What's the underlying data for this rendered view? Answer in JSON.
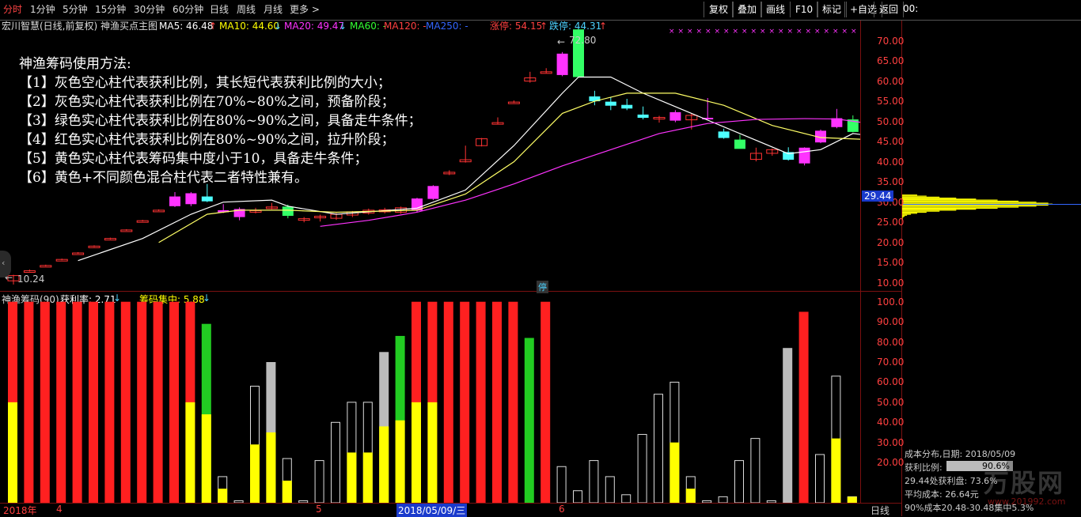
{
  "toolbar": {
    "periods": [
      {
        "label": "分时",
        "active": true
      },
      {
        "label": "1分钟",
        "active": false
      },
      {
        "label": "5分钟",
        "active": false
      },
      {
        "label": "15分钟",
        "active": false
      },
      {
        "label": "30分钟",
        "active": false
      },
      {
        "label": "60分钟",
        "active": false
      },
      {
        "label": "日线",
        "active": false
      },
      {
        "label": "周线",
        "active": false
      },
      {
        "label": "月线",
        "active": false
      },
      {
        "label": "更多 >",
        "active": false
      }
    ],
    "right_buttons": [
      "复权",
      "叠加",
      "画线",
      "F10",
      "标记",
      "+自选",
      "返回"
    ],
    "clock": "00:"
  },
  "info_line": {
    "title": "宏川智慧(日线,前复权) 神渔买点主图",
    "ma5": "MA5: 46.48",
    "ma5_arrow": "↑",
    "ma10": "MA10: 44.60",
    "ma10_arrow": "↓",
    "ma20": "MA20: 49.47",
    "ma20_arrow": "↓",
    "ma60": "MA60: -",
    "ma120": "MA120: -",
    "ma250": "MA250: -",
    "limit_up": "涨停: 54.15",
    "limit_up_arrow": "↑",
    "limit_down": "跌停: 44.31",
    "limit_down_arrow": "↑"
  },
  "instructions": [
    "神渔筹码使用方法:",
    "【1】灰色空心柱代表获利比例，其长短代表获利比例的大小；",
    "【2】灰色实心柱代表获利比例在70%~80%之间，预备阶段；",
    "【3】绿色实心柱代表获利比例在80%~90%之间，具备走牛条件；",
    "【4】红色实心柱代表获利比例在80%~90%之间，拉升阶段；",
    "【5】黄色实心柱代表筹码集中度小于10，具备走牛条件；",
    "【6】黄色+不同颜色混合柱代表二者特性兼有。"
  ],
  "main_axis": {
    "ticks": [
      "70.00",
      "65.00",
      "60.00",
      "55.00",
      "50.00",
      "45.00",
      "40.00",
      "35.00",
      "30.00",
      "25.00",
      "20.00",
      "15.00",
      "10.00"
    ],
    "current_price": "29.44",
    "high_label": "72.80",
    "low_label": "10.24",
    "stop_marker": "停"
  },
  "indicator": {
    "name": "神渔筹码(90)",
    "profit_rate": "获利率: 2.71",
    "profit_arrow": "↓",
    "concentration": "筹码集中: 5.88",
    "conc_arrow": "↓",
    "ticks": [
      "100.0",
      "90.00",
      "80.00",
      "70.00",
      "60.00",
      "50.00",
      "40.00",
      "30.00",
      "20.00"
    ]
  },
  "bottom_axis": {
    "labels": [
      "2018年",
      "4",
      "5",
      "2018/05/09/三",
      "6"
    ],
    "period_label": "日线"
  },
  "cost_distribution": {
    "title": "成本分布,日期: 2018/05/09",
    "profit_ratio_label": "获利比例:",
    "profit_ratio_value": "90.6%",
    "price_profit": "29.44处获利盘: 73.6%",
    "avg_cost": "平均成本: 26.64元",
    "range90": "90%成本20.48-30.48集中5.3%"
  },
  "watermark": "万股网",
  "watermark_url": "www.201992.com",
  "chart_data": {
    "type": "candlestick+bar",
    "main_ylim": [
      8,
      75
    ],
    "candles": [
      {
        "o": 10.5,
        "h": 12.0,
        "l": 9.6,
        "c": 11.8
      },
      {
        "o": 13.0,
        "h": 13.3,
        "l": 12.8,
        "c": 13.0
      },
      {
        "o": 14.3,
        "h": 14.5,
        "l": 14.1,
        "c": 14.3
      },
      {
        "o": 15.8,
        "h": 16.0,
        "l": 15.6,
        "c": 15.8
      },
      {
        "o": 17.4,
        "h": 17.6,
        "l": 17.2,
        "c": 17.4
      },
      {
        "o": 19.1,
        "h": 19.3,
        "l": 18.9,
        "c": 19.1
      },
      {
        "o": 21.0,
        "h": 21.2,
        "l": 20.8,
        "c": 21.0
      },
      {
        "o": 23.1,
        "h": 23.3,
        "l": 22.9,
        "c": 23.1
      },
      {
        "o": 25.4,
        "h": 25.6,
        "l": 25.2,
        "c": 25.4
      },
      {
        "o": 28.0,
        "h": 28.2,
        "l": 27.8,
        "c": 28.0
      },
      {
        "o": 29.0,
        "h": 32.5,
        "l": 28.8,
        "c": 31.4
      },
      {
        "o": 29.5,
        "h": 32.5,
        "l": 29.0,
        "c": 32.2
      },
      {
        "o": 31.4,
        "h": 34.5,
        "l": 30.0,
        "c": 30.2
      },
      {
        "o": 28.0,
        "h": 29.5,
        "l": 27.3,
        "c": 27.5
      },
      {
        "o": 26.3,
        "h": 28.7,
        "l": 25.5,
        "c": 28.3
      },
      {
        "o": 27.8,
        "h": 28.6,
        "l": 27.2,
        "c": 27.9
      },
      {
        "o": 28.6,
        "h": 29.8,
        "l": 28.2,
        "c": 28.8
      },
      {
        "o": 28.9,
        "h": 29.4,
        "l": 26.0,
        "c": 26.6
      },
      {
        "o": 25.6,
        "h": 26.3,
        "l": 25.0,
        "c": 25.9
      },
      {
        "o": 26.3,
        "h": 26.9,
        "l": 25.2,
        "c": 26.5
      },
      {
        "o": 26.0,
        "h": 27.3,
        "l": 25.6,
        "c": 27.0
      },
      {
        "o": 26.8,
        "h": 27.8,
        "l": 26.3,
        "c": 27.6
      },
      {
        "o": 27.3,
        "h": 28.4,
        "l": 26.9,
        "c": 28.0
      },
      {
        "o": 27.6,
        "h": 28.6,
        "l": 27.2,
        "c": 28.1
      },
      {
        "o": 27.5,
        "h": 28.9,
        "l": 27.1,
        "c": 28.6
      },
      {
        "o": 27.9,
        "h": 31.1,
        "l": 27.5,
        "c": 30.9
      },
      {
        "o": 30.8,
        "h": 34.2,
        "l": 30.5,
        "c": 34.0
      },
      {
        "o": 37.4,
        "h": 37.9,
        "l": 36.7,
        "c": 37.4
      },
      {
        "o": 40.0,
        "h": 44.0,
        "l": 39.8,
        "c": 40.5
      },
      {
        "o": 44.0,
        "h": 45.9,
        "l": 43.8,
        "c": 45.7
      },
      {
        "o": 49.7,
        "h": 51.0,
        "l": 49.3,
        "c": 49.7
      },
      {
        "o": 54.8,
        "h": 55.2,
        "l": 54.6,
        "c": 54.8
      },
      {
        "o": 60.0,
        "h": 62.3,
        "l": 59.6,
        "c": 60.8
      },
      {
        "o": 62.3,
        "h": 63.2,
        "l": 62.0,
        "c": 62.3
      },
      {
        "o": 61.5,
        "h": 67.2,
        "l": 61.2,
        "c": 66.8
      },
      {
        "o": 72.8,
        "h": 72.8,
        "l": 61.0,
        "c": 61.0
      },
      {
        "o": 56.2,
        "h": 57.6,
        "l": 54.0,
        "c": 55.0
      },
      {
        "o": 54.9,
        "h": 55.9,
        "l": 52.8,
        "c": 53.9
      },
      {
        "o": 54.1,
        "h": 55.6,
        "l": 52.8,
        "c": 53.2
      },
      {
        "o": 51.7,
        "h": 53.7,
        "l": 50.5,
        "c": 50.9
      },
      {
        "o": 50.7,
        "h": 51.4,
        "l": 49.7,
        "c": 51.0
      },
      {
        "o": 50.2,
        "h": 52.8,
        "l": 49.8,
        "c": 52.3
      },
      {
        "o": 50.4,
        "h": 51.9,
        "l": 48.0,
        "c": 51.5
      },
      {
        "o": 50.9,
        "h": 55.8,
        "l": 50.5,
        "c": 50.6
      },
      {
        "o": 47.5,
        "h": 48.2,
        "l": 45.7,
        "c": 45.9
      },
      {
        "o": 45.5,
        "h": 46.7,
        "l": 43.3,
        "c": 43.2
      },
      {
        "o": 40.6,
        "h": 43.5,
        "l": 40.1,
        "c": 42.1
      },
      {
        "o": 42.1,
        "h": 43.3,
        "l": 41.5,
        "c": 43.0
      },
      {
        "o": 42.4,
        "h": 43.6,
        "l": 40.3,
        "c": 40.5
      },
      {
        "o": 39.6,
        "h": 43.6,
        "l": 39.1,
        "c": 43.5
      },
      {
        "o": 44.8,
        "h": 48.0,
        "l": 44.6,
        "c": 47.7
      },
      {
        "o": 48.6,
        "h": 53.1,
        "l": 48.3,
        "c": 50.8
      },
      {
        "o": 50.5,
        "h": 51.5,
        "l": 47.3,
        "c": 47.4
      },
      {
        "o": 48.9,
        "h": 49.8,
        "l": 44.6,
        "c": 44.9
      }
    ],
    "ma5": [
      [
        4,
        15.5
      ],
      [
        8,
        21
      ],
      [
        11,
        27
      ],
      [
        13,
        30
      ],
      [
        16,
        30.5
      ],
      [
        17,
        29
      ],
      [
        20,
        27
      ],
      [
        25,
        28.5
      ],
      [
        28,
        33
      ],
      [
        31,
        44
      ],
      [
        34,
        57
      ],
      [
        35,
        61
      ],
      [
        37,
        61
      ],
      [
        39,
        57
      ],
      [
        42,
        52
      ],
      [
        45,
        47
      ],
      [
        48,
        42
      ],
      [
        50,
        43
      ],
      [
        52,
        47
      ],
      [
        53,
        46.5
      ]
    ],
    "ma10": [
      [
        9,
        20
      ],
      [
        12,
        27
      ],
      [
        14,
        28
      ],
      [
        17,
        28
      ],
      [
        20,
        27.5
      ],
      [
        25,
        28
      ],
      [
        28,
        32
      ],
      [
        31,
        40
      ],
      [
        34,
        52
      ],
      [
        36,
        55
      ],
      [
        38,
        57
      ],
      [
        41,
        57
      ],
      [
        44,
        54
      ],
      [
        47,
        49
      ],
      [
        50,
        46
      ],
      [
        53,
        45.5
      ]
    ],
    "ma20": [
      [
        19,
        24
      ],
      [
        22,
        25.5
      ],
      [
        25,
        27.5
      ],
      [
        28,
        30.5
      ],
      [
        31,
        34.5
      ],
      [
        34,
        39
      ],
      [
        37,
        43
      ],
      [
        40,
        47
      ],
      [
        43,
        49.5
      ],
      [
        46,
        50.5
      ],
      [
        49,
        50.7
      ],
      [
        51,
        50.6
      ],
      [
        53,
        49.5
      ]
    ],
    "ind_ylim": [
      0,
      105
    ],
    "bars": [
      {
        "v": 100,
        "c": "red",
        "y": 50
      },
      {
        "v": 100,
        "c": "red",
        "y": 0
      },
      {
        "v": 100,
        "c": "red",
        "y": 0
      },
      {
        "v": 100,
        "c": "red",
        "y": 0
      },
      {
        "v": 100,
        "c": "red",
        "y": 0
      },
      {
        "v": 100,
        "c": "red",
        "y": 0
      },
      {
        "v": 100,
        "c": "red",
        "y": 0
      },
      {
        "v": 100,
        "c": "red",
        "y": 0
      },
      {
        "v": 100,
        "c": "red",
        "y": 0
      },
      {
        "v": 100,
        "c": "red",
        "y": 0
      },
      {
        "v": 100,
        "c": "red",
        "y": 0
      },
      {
        "v": 100,
        "c": "red",
        "y": 50
      },
      {
        "v": 89,
        "c": "green",
        "y": 44
      },
      {
        "v": 13,
        "c": "outline",
        "y": 7
      },
      {
        "v": 1,
        "c": "outline",
        "y": 0
      },
      {
        "v": 58,
        "c": "outline",
        "y": 29
      },
      {
        "v": 70,
        "c": "gray",
        "y": 35
      },
      {
        "v": 22,
        "c": "outline",
        "y": 11
      },
      {
        "v": 1,
        "c": "outline",
        "y": 0
      },
      {
        "v": 21,
        "c": "outline",
        "y": 0
      },
      {
        "v": 40,
        "c": "outline",
        "y": 0
      },
      {
        "v": 50,
        "c": "outline",
        "y": 25
      },
      {
        "v": 50,
        "c": "outline",
        "y": 25
      },
      {
        "v": 75,
        "c": "gray",
        "y": 38
      },
      {
        "v": 83,
        "c": "green",
        "y": 41
      },
      {
        "v": 100,
        "c": "red",
        "y": 50
      },
      {
        "v": 100,
        "c": "red",
        "y": 50
      },
      {
        "v": 100,
        "c": "red",
        "y": 0
      },
      {
        "v": 100,
        "c": "red",
        "y": 0
      },
      {
        "v": 100,
        "c": "red",
        "y": 0
      },
      {
        "v": 100,
        "c": "red",
        "y": 0
      },
      {
        "v": 100,
        "c": "red",
        "y": 0
      },
      {
        "v": 82,
        "c": "green",
        "y": 0
      },
      {
        "v": 100,
        "c": "red",
        "y": 0
      },
      {
        "v": 18,
        "c": "outline",
        "y": 0
      },
      {
        "v": 6,
        "c": "outline",
        "y": 0
      },
      {
        "v": 21,
        "c": "outline",
        "y": 0
      },
      {
        "v": 13,
        "c": "outline",
        "y": 0
      },
      {
        "v": 4,
        "c": "outline",
        "y": 0
      },
      {
        "v": 34,
        "c": "outline",
        "y": 0
      },
      {
        "v": 54,
        "c": "outline",
        "y": 0
      },
      {
        "v": 60,
        "c": "outline",
        "y": 30
      },
      {
        "v": 13,
        "c": "outline",
        "y": 7
      },
      {
        "v": 1,
        "c": "outline",
        "y": 0
      },
      {
        "v": 3,
        "c": "outline",
        "y": 0
      },
      {
        "v": 21,
        "c": "outline",
        "y": 0
      },
      {
        "v": 32,
        "c": "outline",
        "y": 0
      },
      {
        "v": 1,
        "c": "outline",
        "y": 0
      },
      {
        "v": 77,
        "c": "gray",
        "y": 0
      },
      {
        "v": 95,
        "c": "red",
        "y": 0
      },
      {
        "v": 24,
        "c": "outline",
        "y": 0
      },
      {
        "v": 63,
        "c": "outline",
        "y": 32
      },
      {
        "v": 3,
        "c": "outline",
        "y": 3
      }
    ],
    "cost_profile_ylim": [
      23,
      32
    ]
  }
}
